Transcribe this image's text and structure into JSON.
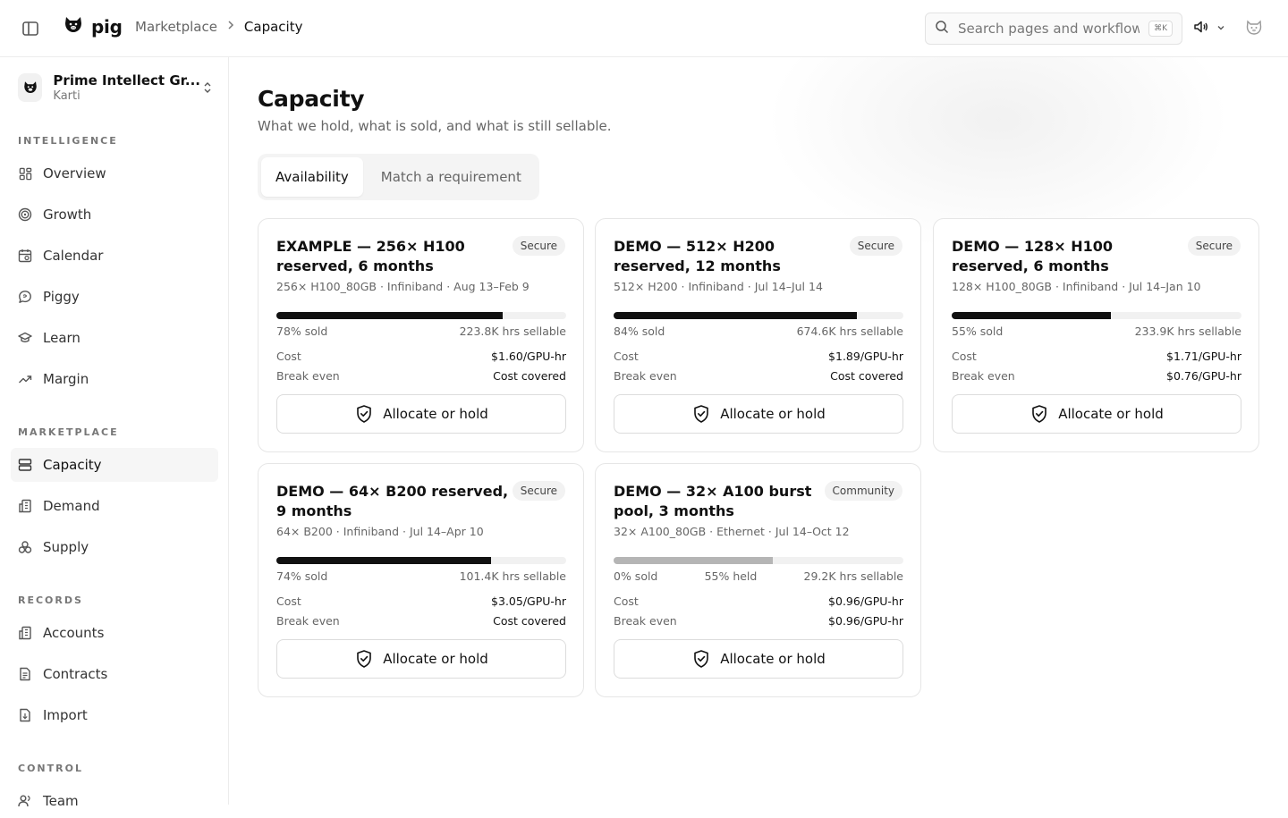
{
  "header": {
    "brand": "pig",
    "breadcrumb": [
      "Marketplace",
      "Capacity"
    ],
    "search_placeholder": "Search pages and workflows...",
    "search_shortcut": "⌘K"
  },
  "sidebar": {
    "org_name": "Prime Intellect Gr...",
    "org_user": "Karti",
    "sections": [
      {
        "label": "INTELLIGENCE",
        "items": [
          "Overview",
          "Growth",
          "Calendar",
          "Piggy",
          "Learn",
          "Margin"
        ]
      },
      {
        "label": "MARKETPLACE",
        "items": [
          "Capacity",
          "Demand",
          "Supply"
        ]
      },
      {
        "label": "RECORDS",
        "items": [
          "Accounts",
          "Contracts",
          "Import"
        ]
      },
      {
        "label": "CONTROL",
        "items": [
          "Team"
        ]
      }
    ]
  },
  "main": {
    "title": "Capacity",
    "subtitle": "What we hold, what is sold, and what is still sellable.",
    "tabs": [
      "Availability",
      "Match a requirement"
    ],
    "cost_label": "Cost",
    "break_even_label": "Break even",
    "button_label": "Allocate or hold",
    "cards": [
      {
        "title": "EXAMPLE — 256× H100 reserved, 6 months",
        "badge": "Secure",
        "meta": "256× H100_80GB · Infiniband · Aug 13–Feb 9",
        "sold_fraction": 0.78,
        "sold_label": "78% sold",
        "held_label": "",
        "sellable": "223.8K hrs sellable",
        "cost": "$1.60/GPU-hr",
        "break_even": "Cost covered"
      },
      {
        "title": "DEMO — 512× H200 reserved, 12 months",
        "badge": "Secure",
        "meta": "512× H200 · Infiniband · Jul 14–Jul 14",
        "sold_fraction": 0.84,
        "sold_label": "84% sold",
        "held_label": "",
        "sellable": "674.6K hrs sellable",
        "cost": "$1.89/GPU-hr",
        "break_even": "Cost covered"
      },
      {
        "title": "DEMO — 128× H100 reserved, 6 months",
        "badge": "Secure",
        "meta": "128× H100_80GB · Infiniband · Jul 14–Jan 10",
        "sold_fraction": 0.55,
        "sold_label": "55% sold",
        "held_label": "",
        "sellable": "233.9K hrs sellable",
        "cost": "$1.71/GPU-hr",
        "break_even": "$0.76/GPU-hr"
      },
      {
        "title": "DEMO — 64× B200 reserved, 9 months",
        "badge": "Secure",
        "meta": "64× B200 · Infiniband · Jul 14–Apr 10",
        "sold_fraction": 0.74,
        "sold_label": "74% sold",
        "held_label": "",
        "sellable": "101.4K hrs sellable",
        "cost": "$3.05/GPU-hr",
        "break_even": "Cost covered"
      },
      {
        "title": "DEMO — 32× A100 burst pool, 3 months",
        "badge": "Community",
        "meta": "32× A100_80GB · Ethernet · Jul 14–Oct 12",
        "sold_fraction": 0.0,
        "held_fraction": 0.55,
        "sold_label": "0% sold",
        "held_label": "55% held",
        "sellable": "29.2K hrs sellable",
        "cost": "$0.96/GPU-hr",
        "break_even": "$0.96/GPU-hr"
      }
    ]
  }
}
